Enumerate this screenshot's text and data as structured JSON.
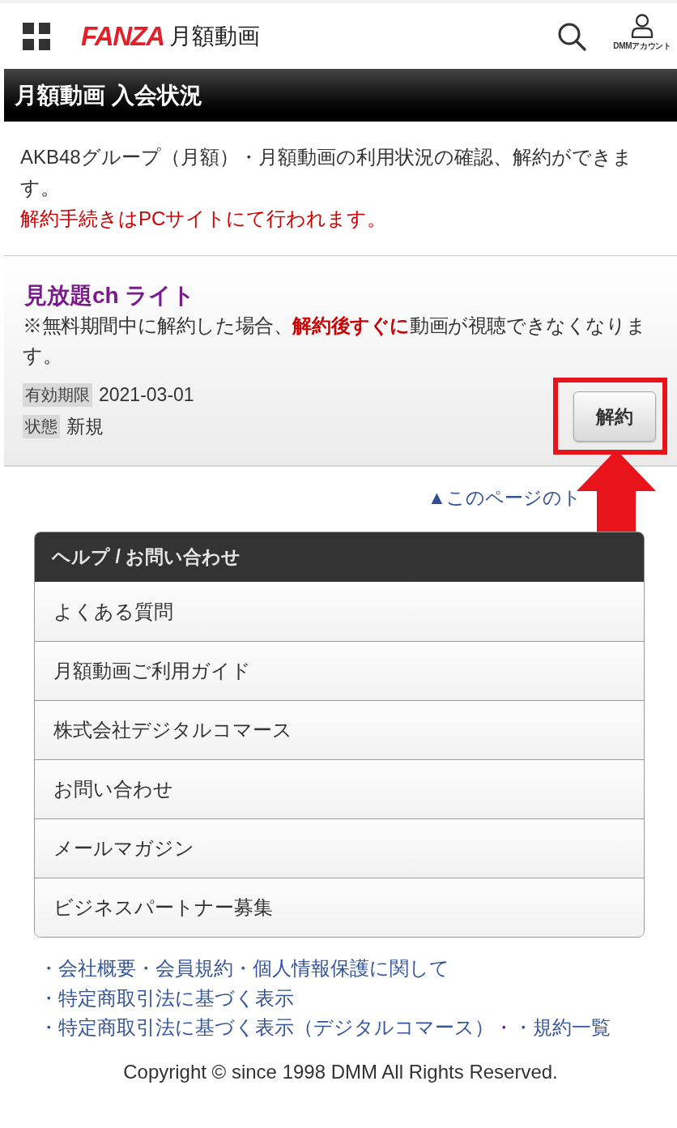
{
  "header": {
    "logo": "FANZA",
    "service": "月額動画",
    "account_label": "DMMアカウント"
  },
  "page_title": "月額動画 入会状況",
  "intro": {
    "text": "AKB48グループ（月額）・月額動画の利用状況の確認、解約ができます。",
    "notice": "解約手続きはPCサイトにて行われます。"
  },
  "plans": [
    {
      "name": "見放題ch ライト",
      "note": "※無料期間中に解約した場合、**解約後すぐに**動画が視聴できなくなります。",
      "fields": [
        {
          "label": "有効期限",
          "value": "2021-03-01"
        },
        {
          "label": "状態",
          "value": "新規"
        }
      ],
      "button": "解約",
      "highlighted": true
    }
  ],
  "page_top_link": "▲このページのト",
  "help": {
    "title": "ヘルプ / お問い合わせ",
    "items": [
      "よくある質問",
      "月額動画ご利用ガイド",
      "株式会社デジタルコマース",
      "お問い合わせ",
      "メールマガジン",
      "ビジネスパートナー募集"
    ]
  },
  "footer_links": [
    {
      "links": [
        {
          "text": "・会社概要・会員規約・個人情報保護に関して",
          "visited": false
        }
      ]
    },
    {
      "links": [
        {
          "text": "・特定商取引法に基づく表示",
          "visited": false
        }
      ]
    },
    {
      "links": [
        {
          "text": "・特定商取引法に基づく表示（デジタルコマース）",
          "visited": false
        },
        {
          "text": "・",
          "visited": true
        },
        {
          "text": "・規約一覧",
          "visited": false
        }
      ]
    }
  ],
  "copyright": "Copyright © since 1998 DMM All Rights Reserved."
}
